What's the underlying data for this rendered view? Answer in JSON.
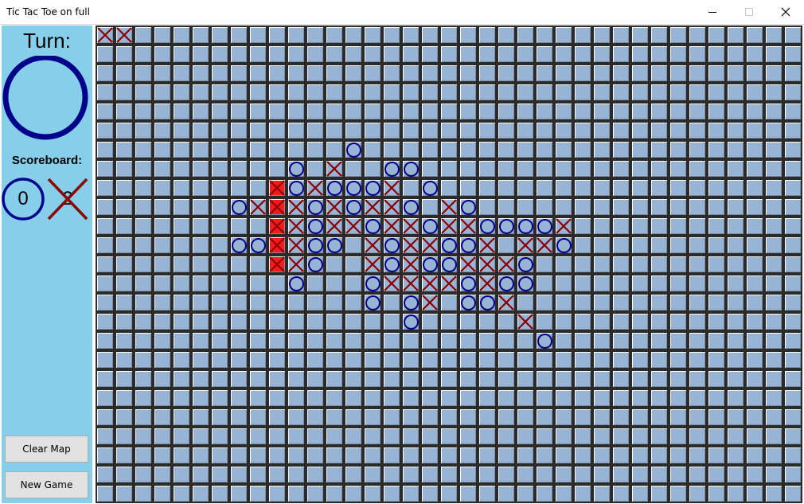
{
  "window": {
    "title": "Tic Tac Toe on full",
    "controls": [
      "minimize",
      "maximize",
      "close"
    ]
  },
  "sidebar": {
    "turn_label": "Turn:",
    "turn_player": "O",
    "scoreboard_label": "Scoreboard:",
    "scores": {
      "o": "0",
      "x": "2"
    },
    "clear_map_label": "Clear Map",
    "new_game_label": "New Game"
  },
  "board": {
    "columns": 37,
    "rows": 25,
    "cells": [
      {
        "row": 0,
        "col": 0,
        "mark": "X"
      },
      {
        "row": 0,
        "col": 1,
        "mark": "X"
      },
      {
        "row": 6,
        "col": 13,
        "mark": "O"
      },
      {
        "row": 7,
        "col": 10,
        "mark": "O"
      },
      {
        "row": 7,
        "col": 12,
        "mark": "X"
      },
      {
        "row": 7,
        "col": 15,
        "mark": "O"
      },
      {
        "row": 7,
        "col": 16,
        "mark": "O"
      },
      {
        "row": 8,
        "col": 9,
        "mark": "X",
        "win": true
      },
      {
        "row": 8,
        "col": 10,
        "mark": "O"
      },
      {
        "row": 8,
        "col": 11,
        "mark": "X"
      },
      {
        "row": 8,
        "col": 12,
        "mark": "O"
      },
      {
        "row": 8,
        "col": 13,
        "mark": "O"
      },
      {
        "row": 8,
        "col": 14,
        "mark": "O"
      },
      {
        "row": 8,
        "col": 15,
        "mark": "X"
      },
      {
        "row": 8,
        "col": 17,
        "mark": "O"
      },
      {
        "row": 9,
        "col": 7,
        "mark": "O"
      },
      {
        "row": 9,
        "col": 8,
        "mark": "X"
      },
      {
        "row": 9,
        "col": 9,
        "mark": "X",
        "win": true
      },
      {
        "row": 9,
        "col": 10,
        "mark": "X"
      },
      {
        "row": 9,
        "col": 11,
        "mark": "O"
      },
      {
        "row": 9,
        "col": 12,
        "mark": "X"
      },
      {
        "row": 9,
        "col": 13,
        "mark": "O"
      },
      {
        "row": 9,
        "col": 14,
        "mark": "X"
      },
      {
        "row": 9,
        "col": 15,
        "mark": "X"
      },
      {
        "row": 9,
        "col": 16,
        "mark": "O"
      },
      {
        "row": 9,
        "col": 18,
        "mark": "X"
      },
      {
        "row": 9,
        "col": 19,
        "mark": "O"
      },
      {
        "row": 10,
        "col": 9,
        "mark": "X",
        "win": true
      },
      {
        "row": 10,
        "col": 10,
        "mark": "X"
      },
      {
        "row": 10,
        "col": 11,
        "mark": "O"
      },
      {
        "row": 10,
        "col": 12,
        "mark": "X"
      },
      {
        "row": 10,
        "col": 13,
        "mark": "X"
      },
      {
        "row": 10,
        "col": 14,
        "mark": "O"
      },
      {
        "row": 10,
        "col": 15,
        "mark": "X"
      },
      {
        "row": 10,
        "col": 16,
        "mark": "X"
      },
      {
        "row": 10,
        "col": 17,
        "mark": "O"
      },
      {
        "row": 10,
        "col": 18,
        "mark": "X"
      },
      {
        "row": 10,
        "col": 19,
        "mark": "X"
      },
      {
        "row": 10,
        "col": 20,
        "mark": "O"
      },
      {
        "row": 10,
        "col": 21,
        "mark": "O"
      },
      {
        "row": 10,
        "col": 22,
        "mark": "O"
      },
      {
        "row": 10,
        "col": 23,
        "mark": "O"
      },
      {
        "row": 10,
        "col": 24,
        "mark": "X"
      },
      {
        "row": 11,
        "col": 7,
        "mark": "O"
      },
      {
        "row": 11,
        "col": 8,
        "mark": "O"
      },
      {
        "row": 11,
        "col": 9,
        "mark": "X",
        "win": true
      },
      {
        "row": 11,
        "col": 10,
        "mark": "X"
      },
      {
        "row": 11,
        "col": 11,
        "mark": "O"
      },
      {
        "row": 11,
        "col": 12,
        "mark": "O"
      },
      {
        "row": 11,
        "col": 14,
        "mark": "X"
      },
      {
        "row": 11,
        "col": 15,
        "mark": "O"
      },
      {
        "row": 11,
        "col": 16,
        "mark": "X"
      },
      {
        "row": 11,
        "col": 17,
        "mark": "X"
      },
      {
        "row": 11,
        "col": 18,
        "mark": "O"
      },
      {
        "row": 11,
        "col": 19,
        "mark": "O"
      },
      {
        "row": 11,
        "col": 20,
        "mark": "X"
      },
      {
        "row": 11,
        "col": 22,
        "mark": "X"
      },
      {
        "row": 11,
        "col": 23,
        "mark": "X"
      },
      {
        "row": 11,
        "col": 24,
        "mark": "O"
      },
      {
        "row": 12,
        "col": 9,
        "mark": "X",
        "win": true
      },
      {
        "row": 12,
        "col": 10,
        "mark": "X"
      },
      {
        "row": 12,
        "col": 11,
        "mark": "O"
      },
      {
        "row": 12,
        "col": 14,
        "mark": "X"
      },
      {
        "row": 12,
        "col": 15,
        "mark": "O"
      },
      {
        "row": 12,
        "col": 16,
        "mark": "X"
      },
      {
        "row": 12,
        "col": 17,
        "mark": "O"
      },
      {
        "row": 12,
        "col": 18,
        "mark": "O"
      },
      {
        "row": 12,
        "col": 19,
        "mark": "X"
      },
      {
        "row": 12,
        "col": 20,
        "mark": "X"
      },
      {
        "row": 12,
        "col": 21,
        "mark": "X"
      },
      {
        "row": 12,
        "col": 22,
        "mark": "O"
      },
      {
        "row": 13,
        "col": 10,
        "mark": "O"
      },
      {
        "row": 13,
        "col": 14,
        "mark": "O"
      },
      {
        "row": 13,
        "col": 15,
        "mark": "X"
      },
      {
        "row": 13,
        "col": 16,
        "mark": "X"
      },
      {
        "row": 13,
        "col": 17,
        "mark": "X"
      },
      {
        "row": 13,
        "col": 18,
        "mark": "X"
      },
      {
        "row": 13,
        "col": 19,
        "mark": "O"
      },
      {
        "row": 13,
        "col": 20,
        "mark": "X"
      },
      {
        "row": 13,
        "col": 21,
        "mark": "O"
      },
      {
        "row": 13,
        "col": 22,
        "mark": "O"
      },
      {
        "row": 14,
        "col": 14,
        "mark": "O"
      },
      {
        "row": 14,
        "col": 16,
        "mark": "O"
      },
      {
        "row": 14,
        "col": 17,
        "mark": "X"
      },
      {
        "row": 14,
        "col": 19,
        "mark": "O"
      },
      {
        "row": 14,
        "col": 20,
        "mark": "O"
      },
      {
        "row": 14,
        "col": 21,
        "mark": "X"
      },
      {
        "row": 15,
        "col": 16,
        "mark": "O"
      },
      {
        "row": 15,
        "col": 22,
        "mark": "X"
      },
      {
        "row": 16,
        "col": 23,
        "mark": "O"
      }
    ]
  },
  "colors": {
    "sidebar_bg": "#87ceeb",
    "cell_bg": "#98b4d4",
    "grid_line": "#2a2a2a",
    "x_mark": "#8b0000",
    "o_mark": "#00008b",
    "win_cell": "#ff1a1a"
  }
}
